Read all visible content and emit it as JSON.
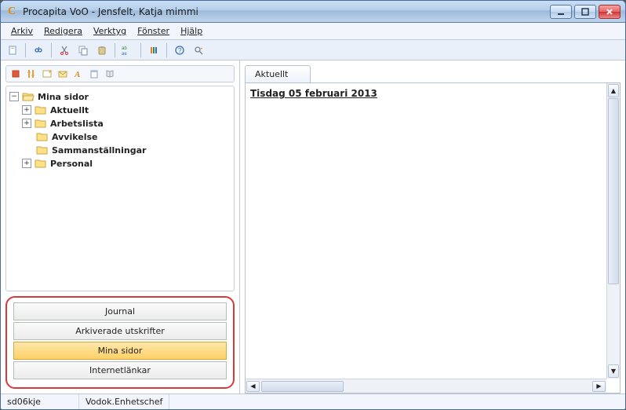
{
  "window": {
    "title": "Procapita VoO - Jensfelt, Katja mimmi"
  },
  "menu": {
    "arkiv": "Arkiv",
    "redigera": "Redigera",
    "verktyg": "Verktyg",
    "fonster": "Fönster",
    "hjalp": "Hjälp"
  },
  "toolbar": {
    "icons": {
      "new": "new-document-icon",
      "search": "binoculars-icon",
      "cut": "scissors-icon",
      "copy": "copy-icon",
      "paste": "paste-icon",
      "replace": "ab-ae-icon",
      "settings": "sliders-icon",
      "help": "help-icon",
      "find_next": "magnifier-icon"
    }
  },
  "sidebar_toolbar": {
    "icons": [
      "stop-icon",
      "sliders-icon",
      "edit-icon",
      "mail-icon",
      "font-a-icon",
      "journal-icon",
      "book-icon"
    ]
  },
  "tree": {
    "root": {
      "label": "Mina sidor",
      "expanded": true
    },
    "children": [
      {
        "label": "Aktuellt",
        "expandable": true
      },
      {
        "label": "Arbetslista",
        "expandable": true
      },
      {
        "label": "Avvikelse",
        "expandable": false
      },
      {
        "label": "Sammanställningar",
        "expandable": false
      },
      {
        "label": "Personal",
        "expandable": true
      }
    ]
  },
  "nav": {
    "items": [
      {
        "label": "Journal",
        "active": false
      },
      {
        "label": "Arkiverade utskrifter",
        "active": false
      },
      {
        "label": "Mina sidor",
        "active": true
      },
      {
        "label": "Internetlänkar",
        "active": false
      }
    ]
  },
  "tabs": {
    "active": "Aktuellt"
  },
  "main": {
    "heading": "Tisdag 05 februari 2013"
  },
  "status": {
    "user": "sd06kje",
    "role": "Vodok.Enhetschef"
  }
}
